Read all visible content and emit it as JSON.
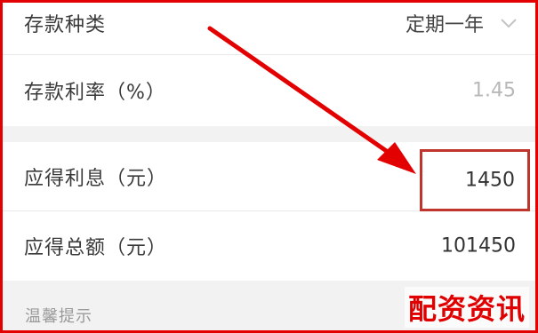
{
  "deposit_type": {
    "label": "存款种类",
    "value": "定期一年",
    "icon": "chevron-down-icon"
  },
  "interest_rate": {
    "label": "存款利率（%）",
    "value": "1.45"
  },
  "interest_due": {
    "label": "应得利息（元）",
    "value": "1450"
  },
  "total_due": {
    "label": "应得总额（元）",
    "value": "101450"
  },
  "tip": {
    "label": "温馨提示"
  },
  "annotation": {
    "highlight_color": "#c0352b",
    "arrow_color": "#e30000"
  },
  "watermark": {
    "text": "配资资讯",
    "color": "#e00000"
  }
}
